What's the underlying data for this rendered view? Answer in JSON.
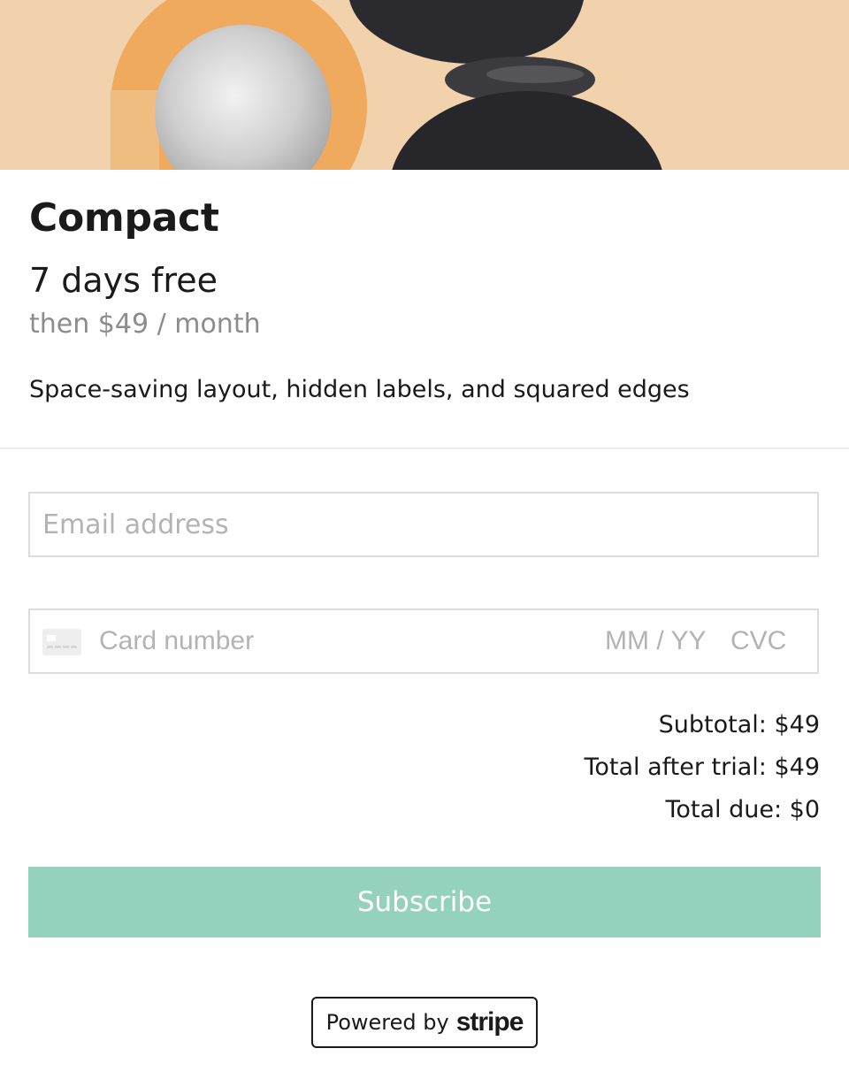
{
  "plan": {
    "title": "Compact",
    "trial": "7 days free",
    "then_price": "then $49 / month",
    "description": "Space-saving layout, hidden labels, and squared edges"
  },
  "form": {
    "email_placeholder": "Email address",
    "card_number_placeholder": "Card number",
    "card_expiry_placeholder": "MM / YY",
    "card_cvc_placeholder": "CVC"
  },
  "totals": {
    "subtotal": "Subtotal: $49",
    "after_trial": "Total after trial: $49",
    "due": "Total due: $0"
  },
  "subscribe_label": "Subscribe",
  "footer": {
    "powered_by": "Powered by",
    "brand": "stripe"
  },
  "colors": {
    "accent_button": "#94d2bd",
    "muted_text": "#8c8c8c",
    "hero_background": "#f1d2ad"
  }
}
